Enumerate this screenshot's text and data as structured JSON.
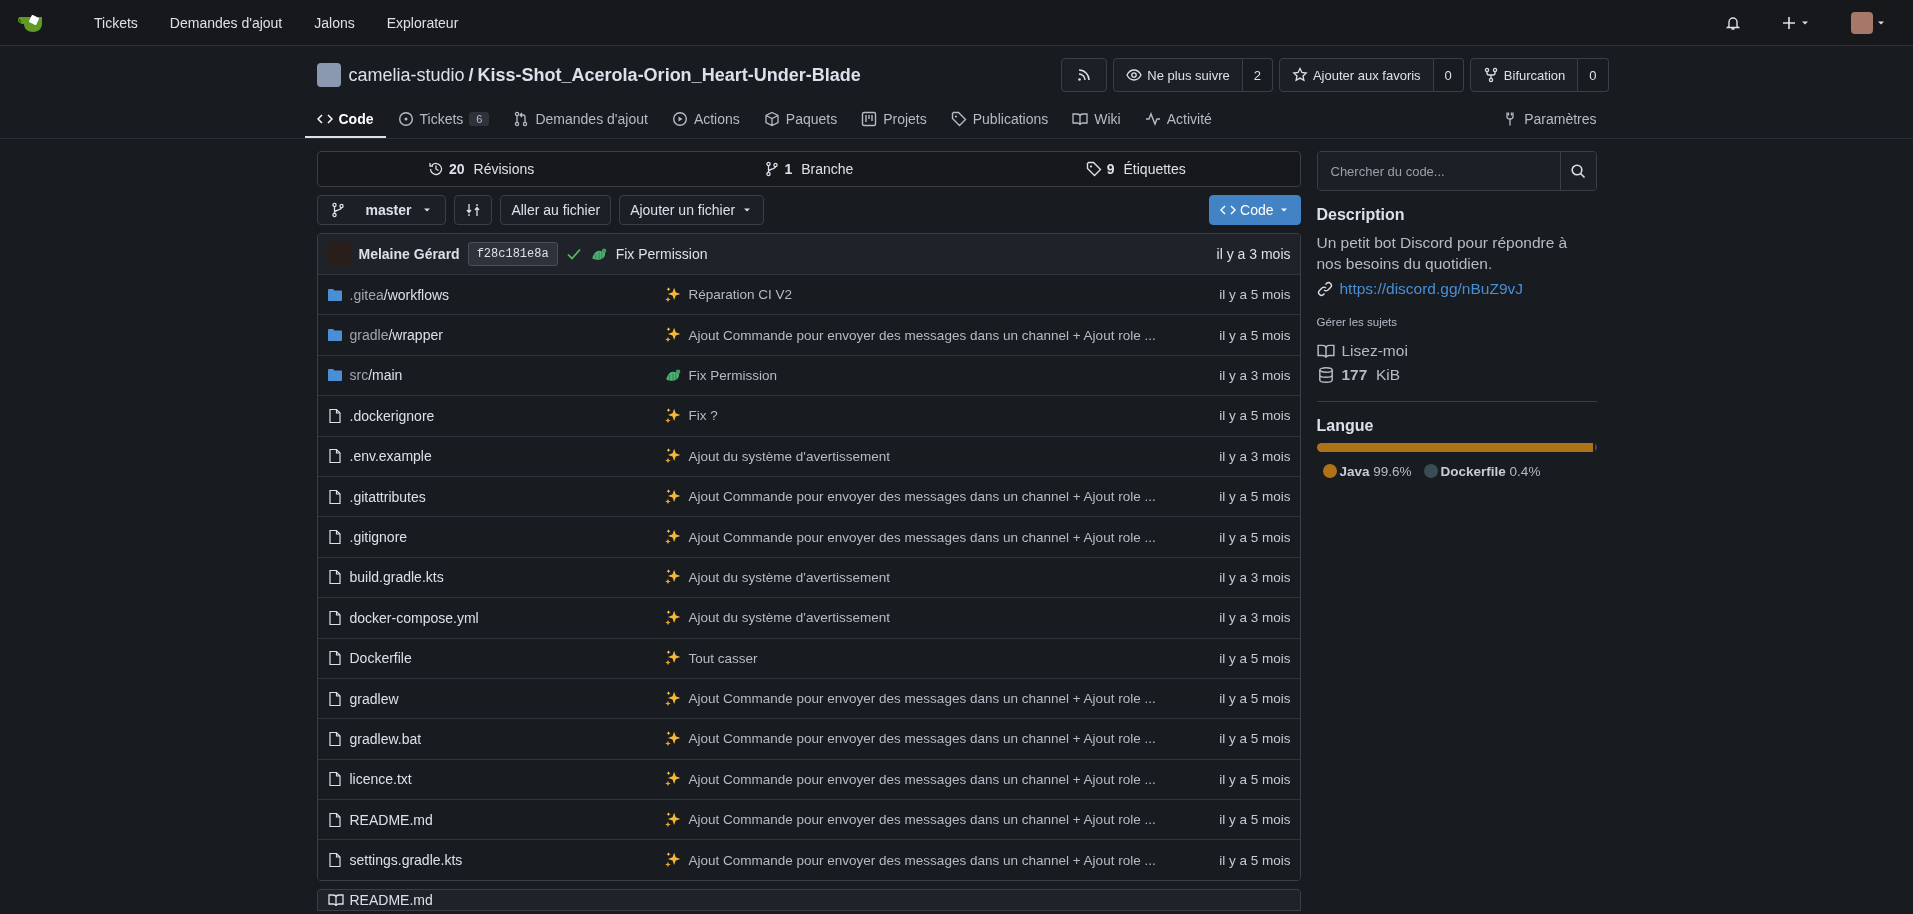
{
  "topnav": {
    "links": [
      "Tickets",
      "Demandes d'ajout",
      "Jalons",
      "Explorateur"
    ]
  },
  "repo": {
    "owner": "camelia-studio",
    "separator": "/",
    "name": "Kiss-Shot_Acerola-Orion_Heart-Under-Blade",
    "actions": [
      {
        "kind": "rss"
      },
      {
        "kind": "watch",
        "label": "Ne plus suivre",
        "count": "2"
      },
      {
        "kind": "star",
        "label": "Ajouter aux favoris",
        "count": "0"
      },
      {
        "kind": "fork",
        "label": "Bifurcation",
        "count": "0"
      }
    ],
    "tabs": [
      {
        "label": "Code",
        "selected": true
      },
      {
        "label": "Tickets",
        "badge": "6",
        "selected": false
      },
      {
        "label": "Demandes d'ajout",
        "selected": false
      },
      {
        "label": "Actions",
        "selected": false
      },
      {
        "label": "Paquets",
        "selected": false
      },
      {
        "label": "Projets",
        "selected": false
      },
      {
        "label": "Publications",
        "selected": false
      },
      {
        "label": "Wiki",
        "selected": false
      },
      {
        "label": "Activité",
        "selected": false
      }
    ],
    "settings_tab": {
      "label": "Paramètres",
      "selected": false
    }
  },
  "stats": [
    {
      "count": "20",
      "label": "Révisions"
    },
    {
      "count": "1",
      "label": "Branche"
    },
    {
      "count": "9",
      "label": "Étiquettes"
    }
  ],
  "toolbar": {
    "branch": "master",
    "go_to_file": "Aller au fichier",
    "add_file": "Ajouter un fichier",
    "code_button": "Code"
  },
  "latest_commit": {
    "author": "Melaine Gérard",
    "sha": "f28c181e8a",
    "checks_passed": true,
    "kind": "bug",
    "message": "Fix Permission",
    "time": "il y a 3 mois"
  },
  "files": [
    {
      "kind": "folder",
      "prefix": ".gitea",
      "name": "/workflows",
      "commit": {
        "kind": "sparkles",
        "message": "Réparation CI V2"
      },
      "time": "il y a 5 mois"
    },
    {
      "kind": "folder",
      "prefix": "gradle",
      "name": "/wrapper",
      "commit": {
        "kind": "sparkles",
        "message": "Ajout Commande pour envoyer des messages dans un channel + Ajout role ..."
      },
      "time": "il y a 5 mois"
    },
    {
      "kind": "folder",
      "prefix": "src",
      "name": "/main",
      "commit": {
        "kind": "bug",
        "message": "Fix Permission"
      },
      "time": "il y a 3 mois"
    },
    {
      "kind": "file",
      "name": ".dockerignore",
      "commit": {
        "kind": "sparkles",
        "message": "Fix ?"
      },
      "time": "il y a 5 mois"
    },
    {
      "kind": "file",
      "name": ".env.example",
      "commit": {
        "kind": "sparkles",
        "message": "Ajout du système d'avertissement"
      },
      "time": "il y a 3 mois"
    },
    {
      "kind": "file",
      "name": ".gitattributes",
      "commit": {
        "kind": "sparkles",
        "message": "Ajout Commande pour envoyer des messages dans un channel + Ajout role ..."
      },
      "time": "il y a 5 mois"
    },
    {
      "kind": "file",
      "name": ".gitignore",
      "commit": {
        "kind": "sparkles",
        "message": "Ajout Commande pour envoyer des messages dans un channel + Ajout role ..."
      },
      "time": "il y a 5 mois"
    },
    {
      "kind": "file",
      "name": "build.gradle.kts",
      "commit": {
        "kind": "sparkles",
        "message": "Ajout du système d'avertissement"
      },
      "time": "il y a 3 mois"
    },
    {
      "kind": "file",
      "name": "docker-compose.yml",
      "commit": {
        "kind": "sparkles",
        "message": "Ajout du système d'avertissement"
      },
      "time": "il y a 3 mois"
    },
    {
      "kind": "file",
      "name": "Dockerfile",
      "commit": {
        "kind": "sparkles",
        "message": "Tout casser"
      },
      "time": "il y a 5 mois"
    },
    {
      "kind": "file",
      "name": "gradlew",
      "commit": {
        "kind": "sparkles",
        "message": "Ajout Commande pour envoyer des messages dans un channel + Ajout role ..."
      },
      "time": "il y a 5 mois"
    },
    {
      "kind": "file",
      "name": "gradlew.bat",
      "commit": {
        "kind": "sparkles",
        "message": "Ajout Commande pour envoyer des messages dans un channel + Ajout role ..."
      },
      "time": "il y a 5 mois"
    },
    {
      "kind": "file",
      "name": "licence.txt",
      "commit": {
        "kind": "sparkles",
        "message": "Ajout Commande pour envoyer des messages dans un channel + Ajout role ..."
      },
      "time": "il y a 5 mois"
    },
    {
      "kind": "file",
      "name": "README.md",
      "commit": {
        "kind": "sparkles",
        "message": "Ajout Commande pour envoyer des messages dans un channel + Ajout role ..."
      },
      "time": "il y a 5 mois"
    },
    {
      "kind": "file",
      "name": "settings.gradle.kts",
      "commit": {
        "kind": "sparkles",
        "message": "Ajout Commande pour envoyer des messages dans un channel + Ajout role ..."
      },
      "time": "il y a 5 mois"
    }
  ],
  "readme": {
    "title": "README.md"
  },
  "sidebar": {
    "search": {
      "placeholder": "Chercher du code..."
    },
    "description_title": "Description",
    "description": "Un petit bot Discord pour répondre à nos besoins du quotidien.",
    "link": "https://discord.gg/nBuZ9vJ",
    "topics": "Gérer les sujets",
    "readme": "Lisez-moi",
    "size_value": "177",
    "size_unit": "KiB",
    "languages_title": "Langue",
    "languages": [
      {
        "name": "Java",
        "percent": "99.6%",
        "level": 0.996,
        "color": "#b07219"
      },
      {
        "name": "Dockerfile",
        "percent": "0.4%",
        "level": 0.004,
        "color": "#384d54"
      }
    ]
  }
}
